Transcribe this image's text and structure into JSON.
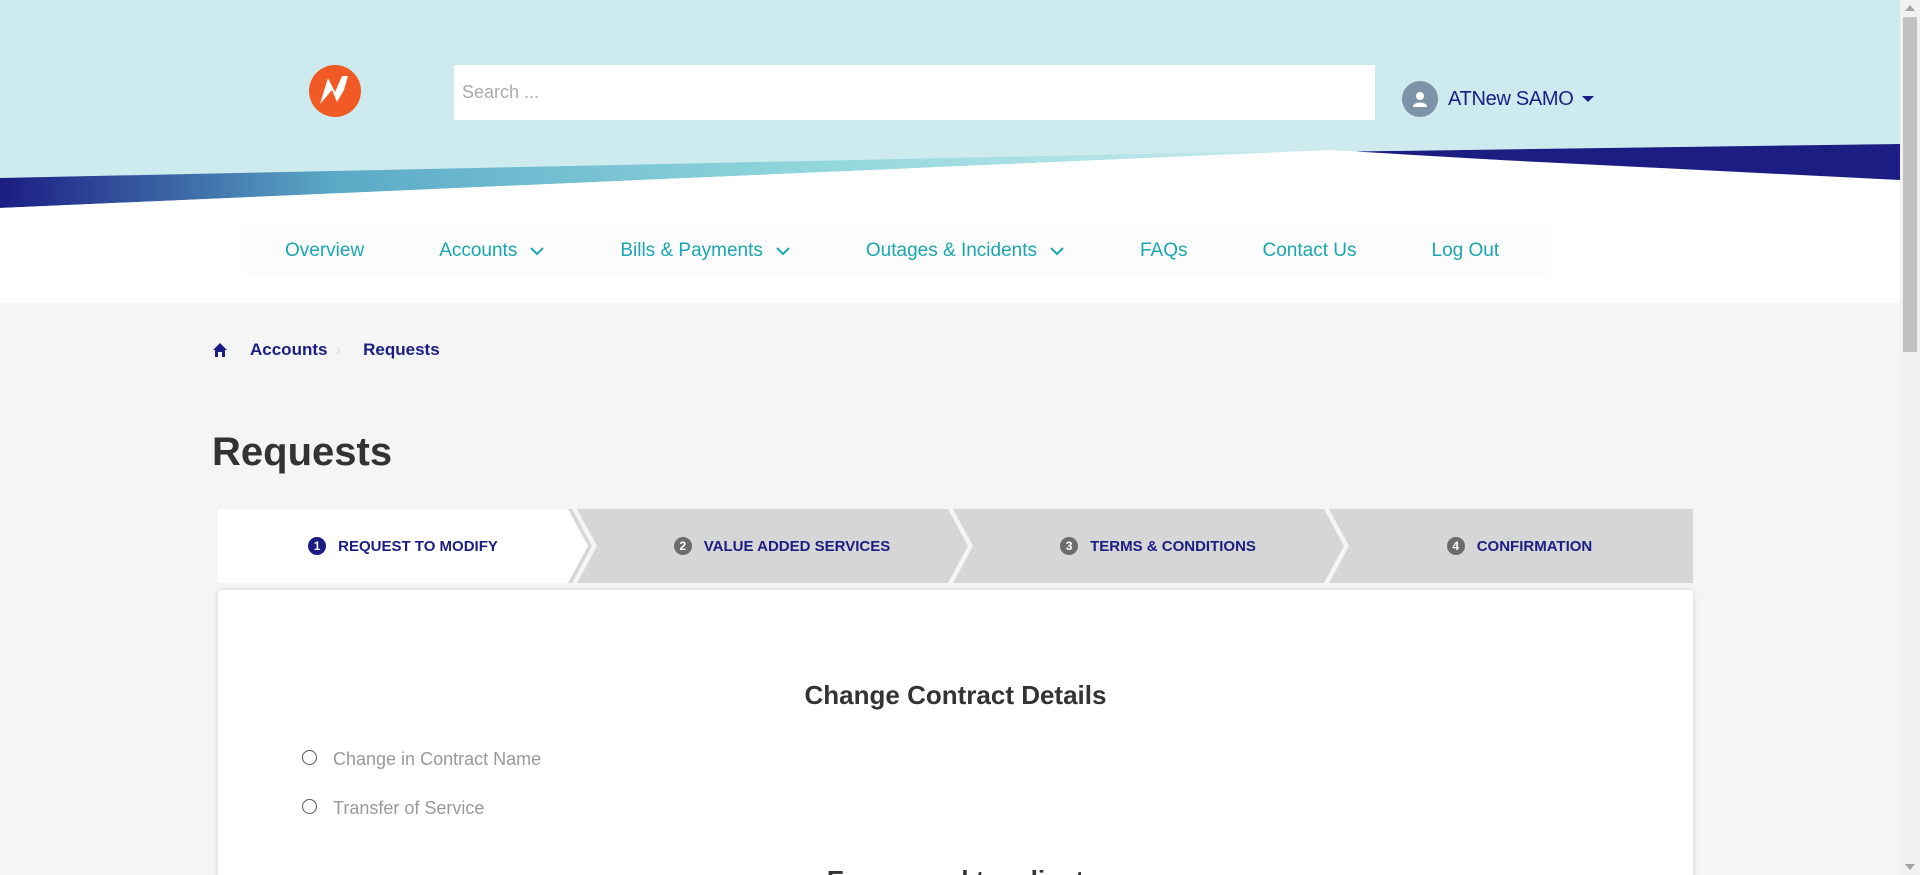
{
  "header": {
    "search_placeholder": "Search ...",
    "user_name": "ATNew SAMO",
    "logo": "lightning-logo",
    "colors": {
      "header_bg": "#cdebee",
      "brand_navy": "#1b1d83",
      "brand_teal": "#1aa6b0",
      "logo_orange": "#f15a24"
    }
  },
  "nav": {
    "items": [
      {
        "label": "Overview"
      },
      {
        "label": "Accounts"
      },
      {
        "label": "Bills & Payments"
      },
      {
        "label": "Outages & Incidents"
      },
      {
        "label": "FAQs"
      },
      {
        "label": "Contact Us"
      },
      {
        "label": "Log Out"
      }
    ]
  },
  "breadcrumb": {
    "home_icon": "home-icon",
    "items": [
      "Accounts",
      "Requests"
    ]
  },
  "page": {
    "title": "Requests"
  },
  "stepper": {
    "steps": [
      {
        "num": "1",
        "label": "REQUEST TO MODIFY",
        "active": true
      },
      {
        "num": "2",
        "label": "VALUE ADDED SERVICES",
        "active": false
      },
      {
        "num": "3",
        "label": "TERMS & CONDITIONS",
        "active": false
      },
      {
        "num": "4",
        "label": "CONFIRMATION",
        "active": false
      }
    ]
  },
  "form": {
    "title": "Change Contract Details",
    "options": [
      "Change in Contract Name",
      "Transfer of Service"
    ],
    "next_heading_partial": "Ensure and to adjust"
  }
}
